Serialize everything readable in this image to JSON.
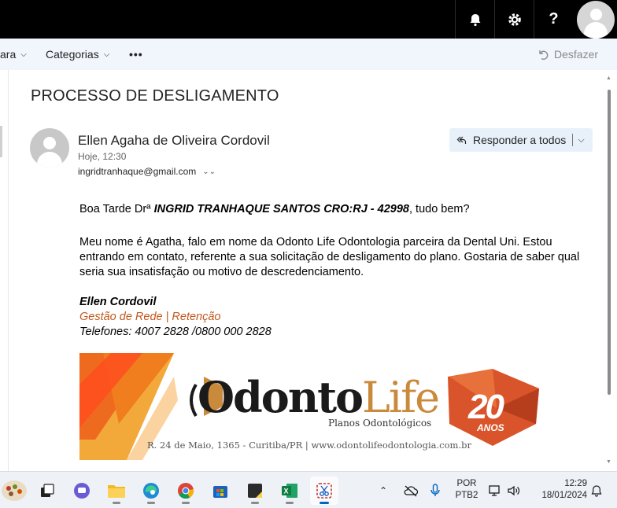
{
  "header": {
    "help_label": "?"
  },
  "command_bar": {
    "partial_item_label": "ara",
    "categories_label": "Categorias",
    "more_label": "•••",
    "undo_label": "Desfazer"
  },
  "email": {
    "subject": "PROCESSO DE DESLIGAMENTO",
    "sender_name": "Ellen Agaha de Oliveira Cordovil",
    "sent_time": "Hoje, 12:30",
    "to_address": "ingridtranhaque@gmail.com",
    "reply_all_label": "Responder a todos",
    "greeting_prefix": "Boa Tarde Drª ",
    "greeting_name": "INGRID TRANHAQUE SANTOS CRO:RJ - 42998",
    "greeting_suffix": ", tudo bem?",
    "paragraph": "Meu nome é Agatha, falo em nome da Odonto Life Odontologia parceira da Dental Uni. Estou entrando em contato, referente a sua solicitação de desligamento do plano. Gostaria de saber qual seria sua insatisfação ou motivo de descredenciamento.",
    "signature": {
      "name": "Ellen Cordovil",
      "department": "Gestão de Rede | Retenção",
      "phones": "Telefones: 4007 2828 /0800 000 2828"
    },
    "banner": {
      "logo_main": "Odonto",
      "logo_life": "Life",
      "subtitle": "Planos Odontológicos",
      "address": "R. 24 de Maio, 1365 - Curitiba/PR  |  www.odontolifeodontologia.com.br",
      "badge_number": "20",
      "badge_word": "ANOS"
    }
  },
  "taskbar": {
    "language_line1": "POR",
    "language_line2": "PTB2",
    "time": "12:29",
    "date": "18/01/2024"
  },
  "colors": {
    "accent_blue": "#0067c0",
    "signature_orange": "#c2571c",
    "command_bar_bg": "#f0f6fc"
  }
}
